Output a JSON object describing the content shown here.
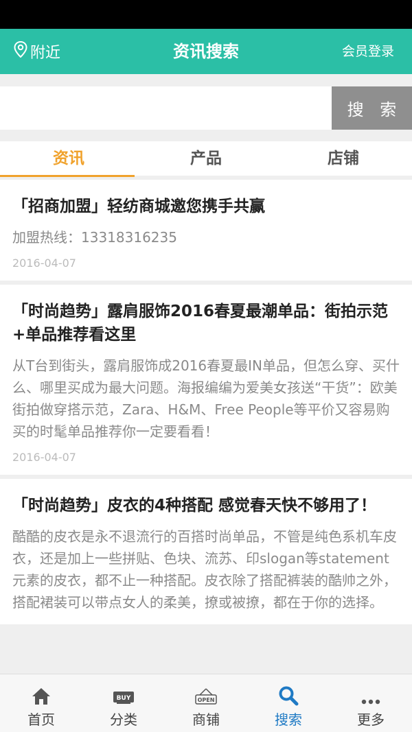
{
  "header": {
    "location_label": "附近",
    "title": "资讯搜索",
    "login_label": "会员登录"
  },
  "search": {
    "placeholder": "",
    "value": "",
    "button_label": "搜 索"
  },
  "tabs": [
    {
      "label": "资讯",
      "active": true
    },
    {
      "label": "产品",
      "active": false
    },
    {
      "label": "店铺",
      "active": false
    }
  ],
  "articles": [
    {
      "title": "「招商加盟」轻纺商城邀您携手共赢",
      "desc": "加盟热线：13318316235",
      "date": "2016-04-07"
    },
    {
      "title": "「时尚趋势」露肩服饰2016春夏最潮单品：街拍示范+单品推荐看这里",
      "desc": "从T台到街头，露肩服饰成2016春夏最IN单品，但怎么穿、买什么、哪里买成为最大问题。海报编编为爱美女孩送“干货”：欧美街拍做穿搭示范，Zara、H&M、Free People等平价又容易购买的时髦单品推荐你一定要看看！",
      "date": "2016-04-07"
    },
    {
      "title": "「时尚趋势」皮衣的4种搭配 感觉春天快不够用了！",
      "desc": "酷酷的皮衣是永不退流行的百搭时尚单品，不管是纯色系机车皮衣，还是加上一些拼贴、色块、流苏、印slogan等statement元素的皮衣，都不止一种搭配。皮衣除了搭配裤装的酷帅之外，搭配裙装可以带点女人的柔美，撩或被撩，都在于你的选择。",
      "date": ""
    }
  ],
  "bottom_nav": [
    {
      "label": "首页",
      "icon": "home-icon",
      "active": false
    },
    {
      "label": "分类",
      "icon": "buy-icon",
      "active": false
    },
    {
      "label": "商铺",
      "icon": "open-sign-icon",
      "active": false
    },
    {
      "label": "搜索",
      "icon": "search-icon",
      "active": true
    },
    {
      "label": "更多",
      "icon": "more-icon",
      "active": false
    }
  ],
  "icon_text": {
    "buy": "BUY",
    "open": "OPEN"
  },
  "colors": {
    "header": "#2bbfa6",
    "tab_active": "#f0a22c",
    "nav_active": "#1f7ac4",
    "search_button": "#8f8f8f"
  }
}
